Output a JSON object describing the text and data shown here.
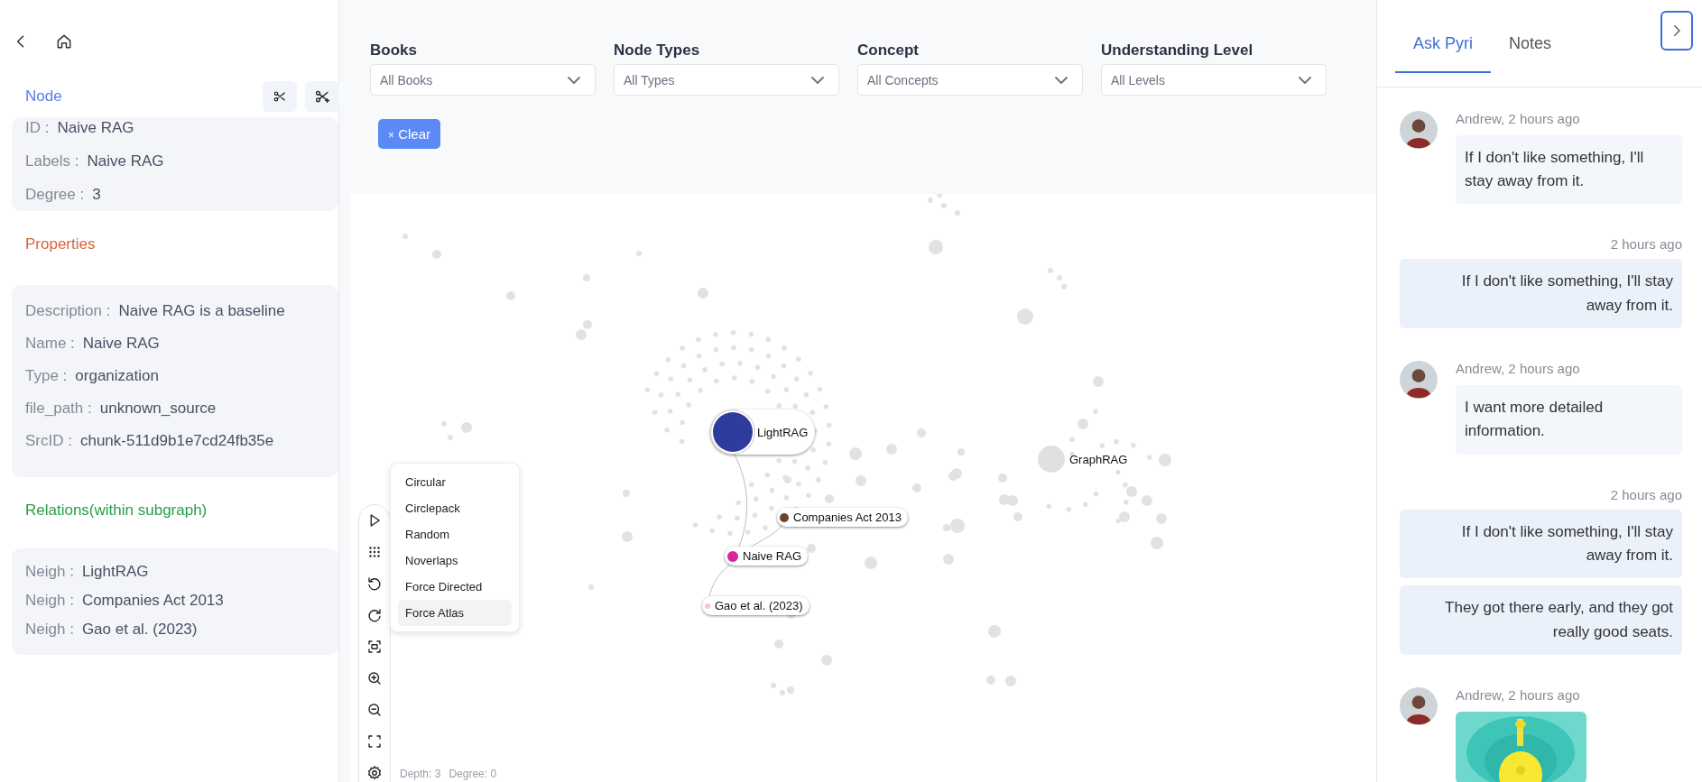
{
  "node_panel": {
    "title": "Node",
    "fields": [
      {
        "key": "ID :",
        "value": "Naive RAG"
      },
      {
        "key": "Labels :",
        "value": "Naive RAG"
      },
      {
        "key": "Degree :",
        "value": "3"
      }
    ]
  },
  "properties": {
    "title": "Properties",
    "fields": [
      {
        "key": "Description :",
        "value": "Naive RAG is a baseline"
      },
      {
        "key": "Name :",
        "value": "Naive RAG"
      },
      {
        "key": "Type :",
        "value": "organization"
      },
      {
        "key": "file_path :",
        "value": "unknown_source"
      },
      {
        "key": "SrcID :",
        "value": "chunk-511d9b1e7cd24fb35e"
      }
    ]
  },
  "relations": {
    "title": "Relations(within subgraph)",
    "fields": [
      {
        "key": "Neigh :",
        "value": "LightRAG"
      },
      {
        "key": "Neigh :",
        "value": "Companies Act 2013"
      },
      {
        "key": "Neigh :",
        "value": "Gao et al. (2023)"
      }
    ]
  },
  "filters": [
    {
      "label": "Books",
      "value": "All Books"
    },
    {
      "label": "Node Types",
      "value": "All Types"
    },
    {
      "label": "Concept",
      "value": "All Concepts"
    },
    {
      "label": "Understanding Level",
      "value": "All Levels"
    }
  ],
  "clear_button": {
    "icon": "×",
    "label": "Clear"
  },
  "graph": {
    "nodes": [
      {
        "label": "LightRAG",
        "color": "#2f3c9e",
        "highlighted": true
      },
      {
        "label": "Companies Act 2013",
        "color": "#6b4430",
        "highlighted": true
      },
      {
        "label": "Naive RAG",
        "color": "#d6249c",
        "highlighted": true
      },
      {
        "label": "Gao et al. (2023)",
        "color": "#f7c6c6",
        "highlighted": true
      },
      {
        "label": "GraphRAG",
        "color": "#e0e0e0",
        "highlighted": false
      }
    ],
    "layout_menu": [
      {
        "label": "Circular",
        "selected": false
      },
      {
        "label": "Circlepack",
        "selected": false
      },
      {
        "label": "Random",
        "selected": false
      },
      {
        "label": "Noverlaps",
        "selected": false
      },
      {
        "label": "Force Directed",
        "selected": false
      },
      {
        "label": "Force Atlas",
        "selected": true
      }
    ],
    "status": [
      "Depth: 3",
      "Degree: 0"
    ]
  },
  "chat": {
    "tabs": [
      {
        "label": "Ask Pyri",
        "selected": true
      },
      {
        "label": "Notes",
        "selected": false
      }
    ],
    "messages": [
      {
        "kind": "incoming",
        "meta": "Andrew, 2 hours ago",
        "bubbles": [
          "If I don't like something, I'll stay away from it."
        ]
      },
      {
        "kind": "outgoing",
        "meta": "2 hours ago",
        "bubbles": [
          "If I don't like something, I'll stay away from it."
        ]
      },
      {
        "kind": "incoming",
        "meta": "Andrew, 2 hours ago",
        "bubbles": [
          "I want more detailed information."
        ]
      },
      {
        "kind": "outgoing",
        "meta": "2 hours ago",
        "bubbles": [
          "If I don't like something, I'll stay away from it.",
          "They got there early, and they got really good seats."
        ]
      },
      {
        "meta": "Andrew, 2 hours ago"
      }
    ]
  }
}
